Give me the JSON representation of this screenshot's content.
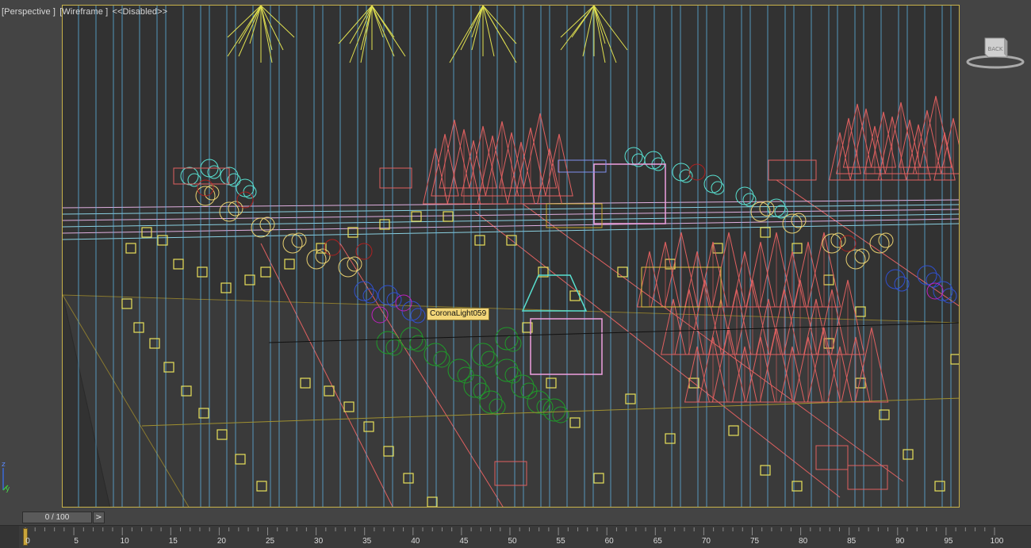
{
  "viewport": {
    "view_label": "[Perspective ]",
    "shading_label": "[Wireframe ]",
    "lighting_label": "<<Disabled>>"
  },
  "tooltip": {
    "text": "CoronaLight059"
  },
  "viewcube": {
    "face_label": "BACK"
  },
  "axis": {
    "z": "z",
    "y": "y"
  },
  "timeline": {
    "frame_display": "0 / 100",
    "next_button": ">",
    "current_frame": 0,
    "ticks": [
      "0",
      "5",
      "10",
      "15",
      "20",
      "25",
      "30",
      "35",
      "40",
      "45",
      "50",
      "55",
      "60",
      "65",
      "70",
      "75",
      "80",
      "85",
      "90",
      "95",
      "100"
    ]
  },
  "colors": {
    "frame_border": "#c8b24a",
    "light_lines": "#5fb7e8",
    "trees_red": "#e06060",
    "trees_green": "#1f9a2a",
    "trees_cyan": "#58e0d0",
    "lights_yellow": "#e8e05a"
  }
}
